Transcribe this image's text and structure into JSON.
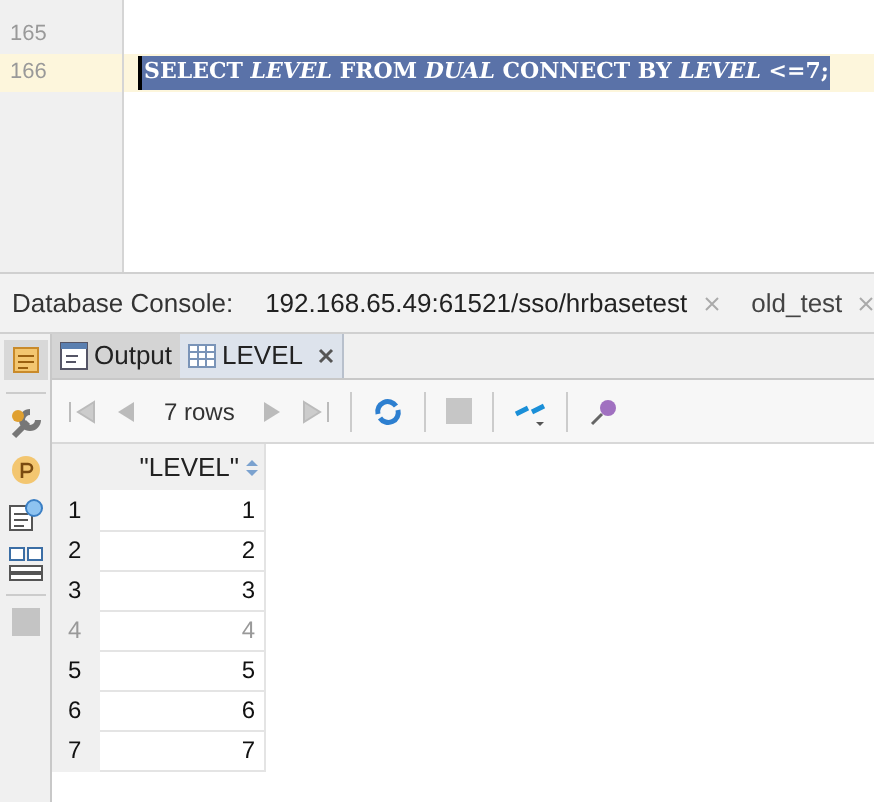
{
  "editor": {
    "lines": [
      {
        "number": "165",
        "current": false
      },
      {
        "number": "166",
        "code": "SELECT *LEVEL* FROM *DUAL* CONNECT BY *LEVEL* <=7;",
        "current": true,
        "selected": true
      }
    ]
  },
  "console_tabs": {
    "label": "Database Console:",
    "tabs": [
      {
        "label": "192.168.65.49:61521/sso/hrbasetest",
        "selected": true
      },
      {
        "label": "old_test",
        "selected": false
      }
    ]
  },
  "result_tabs": [
    {
      "label": "Output",
      "selected": false,
      "closable": false
    },
    {
      "label": "LEVEL",
      "selected": true,
      "closable": true
    }
  ],
  "toolbar": {
    "row_count": "7 rows"
  },
  "table": {
    "columns": [
      "\"LEVEL\""
    ],
    "rows": [
      {
        "number": "1",
        "cells": [
          "1"
        ],
        "dimmed": false
      },
      {
        "number": "2",
        "cells": [
          "2"
        ],
        "dimmed": false
      },
      {
        "number": "3",
        "cells": [
          "3"
        ],
        "dimmed": false
      },
      {
        "number": "4",
        "cells": [
          "4"
        ],
        "dimmed": true
      },
      {
        "number": "5",
        "cells": [
          "5"
        ],
        "dimmed": false
      },
      {
        "number": "6",
        "cells": [
          "6"
        ],
        "dimmed": false
      },
      {
        "number": "7",
        "cells": [
          "7"
        ],
        "dimmed": false
      }
    ]
  }
}
